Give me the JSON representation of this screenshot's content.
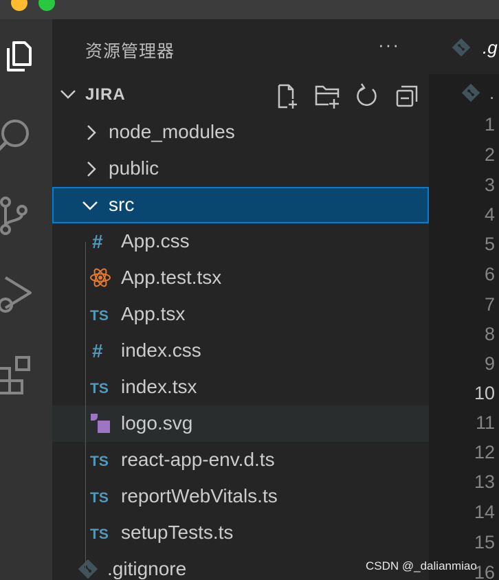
{
  "explorer": {
    "title": "资源管理器",
    "more_label": "···",
    "section_title": "JIRA"
  },
  "tree": [
    {
      "label": "node_modules",
      "kind": "folder",
      "expanded": false,
      "depth": 0
    },
    {
      "label": "public",
      "kind": "folder",
      "expanded": false,
      "depth": 0
    },
    {
      "label": "src",
      "kind": "folder",
      "expanded": true,
      "depth": 0,
      "selected": true
    },
    {
      "label": "App.css",
      "kind": "css",
      "depth": 1
    },
    {
      "label": "App.test.tsx",
      "kind": "react",
      "depth": 1
    },
    {
      "label": "App.tsx",
      "kind": "ts",
      "depth": 1
    },
    {
      "label": "index.css",
      "kind": "css",
      "depth": 1
    },
    {
      "label": "index.tsx",
      "kind": "ts",
      "depth": 1
    },
    {
      "label": "logo.svg",
      "kind": "svg",
      "depth": 1,
      "hover": true
    },
    {
      "label": "react-app-env.d.ts",
      "kind": "ts",
      "depth": 1
    },
    {
      "label": "reportWebVitals.ts",
      "kind": "ts",
      "depth": 1
    },
    {
      "label": "setupTests.ts",
      "kind": "ts",
      "depth": 1
    },
    {
      "label": ".gitignore",
      "kind": "git",
      "depth": 0
    }
  ],
  "icons": {
    "css": "#",
    "ts": "TS"
  },
  "editor": {
    "tab_label": ".g",
    "breadcrumb_label": ".",
    "line_numbers": [
      "1",
      "2",
      "3",
      "4",
      "5",
      "6",
      "7",
      "8",
      "9",
      "10",
      "11",
      "12",
      "13",
      "14",
      "15",
      "16"
    ],
    "active_line": "10"
  },
  "watermark": "CSDN @_dalianmiao",
  "colors": {
    "selected_bg": "#094771",
    "selected_border": "#007fd4",
    "ts_blue": "#519aba",
    "react_orange": "#e37933",
    "svg_purple": "#a074c4",
    "git_gray": "#41535b"
  }
}
